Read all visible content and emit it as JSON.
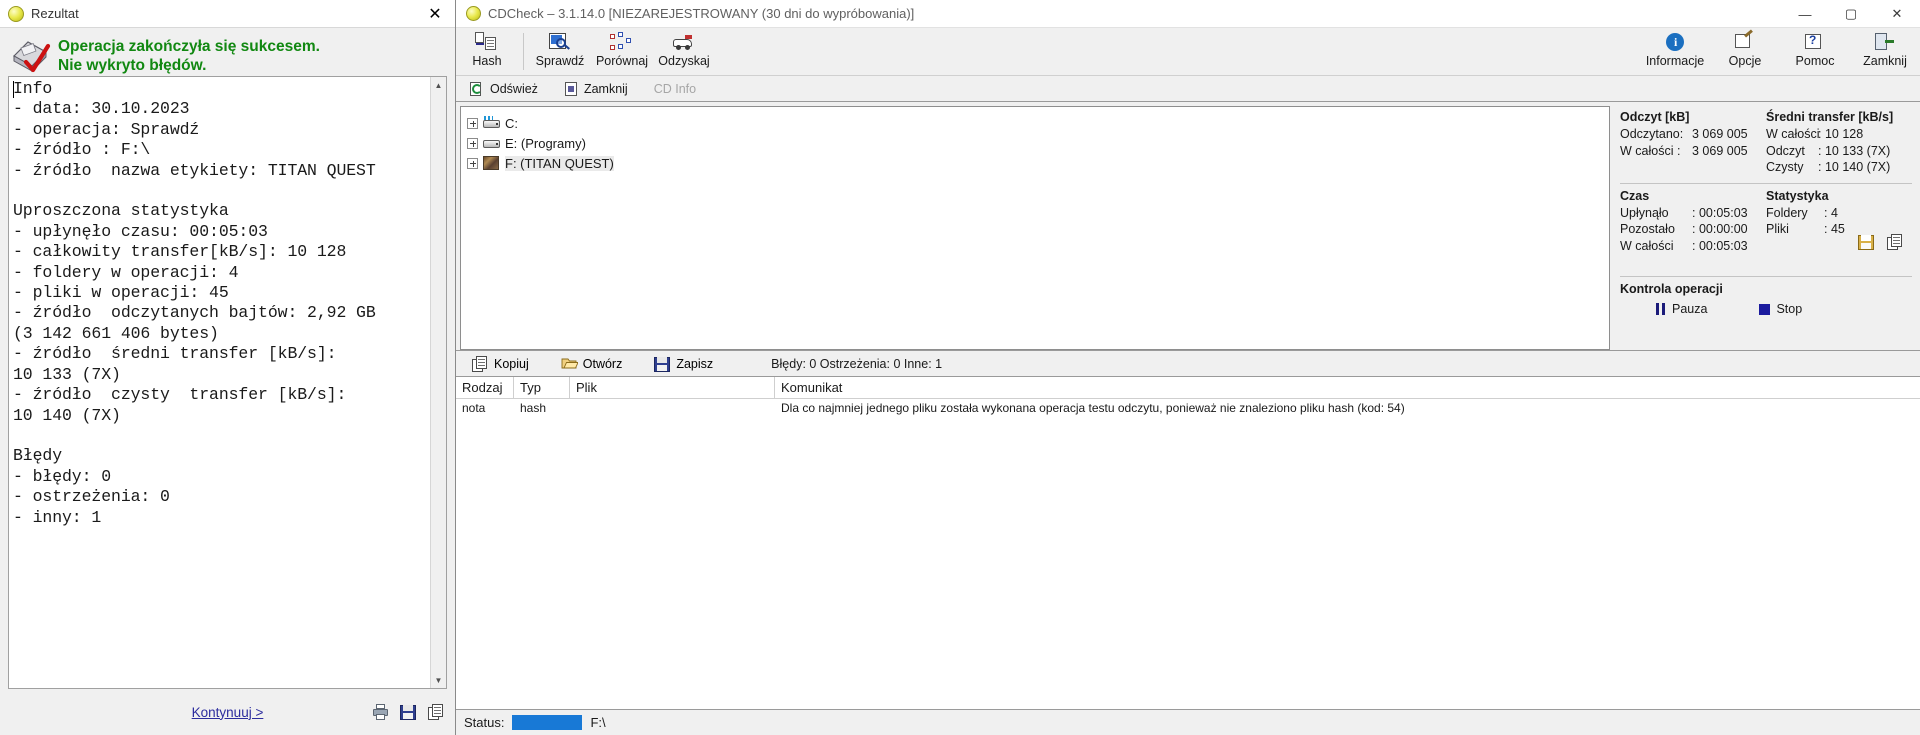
{
  "left_window": {
    "title": "Rezultat",
    "title_icon": "cdcheck-logo-icon",
    "close_label": "✕",
    "banner": {
      "line1": "Operacja zakończyła się sukcesem.",
      "line2": "Nie wykryto błędów.",
      "color": "#118811",
      "icon": "check-disc-icon"
    },
    "report_text": "Info\n- data: 30.10.2023\n- operacja: Sprawdź\n- źródło : F:\\\n- źródło  nazwa etykiety: TITAN QUEST\n\nUproszczona statystyka\n- upłynęło czasu: 00:05:03\n- całkowity transfer[kB/s]: 10 128\n- foldery w operacji: 4\n- pliki w operacji: 45\n- źródło  odczytanych bajtów: 2,92 GB\n(3 142 661 406 bytes)\n- źródło  średni transfer [kB/s]:\n10 133 (7X)\n- źródło  czysty  transfer [kB/s]:\n10 140 (7X)\n\nBłędy\n- błędy: 0\n- ostrzeżenia: 0\n- inny: 1\n",
    "continue_label": "Kontynuuj >",
    "footer_icons": [
      {
        "name": "print-icon",
        "label": "Drukuj"
      },
      {
        "name": "save-icon",
        "label": "Zapisz"
      },
      {
        "name": "copy-icon",
        "label": "Kopiuj"
      }
    ],
    "scroll_up": "▲",
    "scroll_down": "▼"
  },
  "right_window": {
    "title": "CDCheck – 3.1.14.0 [NIEZAREJESTROWANY (30 dni do wypróbowania)]",
    "window_buttons": {
      "minimize": "—",
      "maximize": "▢",
      "close": "✕"
    },
    "toolbar": {
      "left_items": [
        {
          "name": "hash-button",
          "label": "Hash",
          "accel": "H",
          "icon": "hash-document-icon"
        },
        {
          "name": "check-button",
          "label": "Sprawdź",
          "accel": "S",
          "icon": "magnifier-check-icon"
        },
        {
          "name": "compare-button",
          "label": "Porównaj",
          "accel": "o",
          "icon": "compare-nodes-icon"
        },
        {
          "name": "recover-button",
          "label": "Odzyskaj",
          "accel": "s",
          "icon": "ambulance-icon"
        }
      ],
      "right_items": [
        {
          "name": "info-button",
          "label": "Informacje",
          "icon": "info-circle-icon"
        },
        {
          "name": "options-button",
          "label": "Opcje",
          "icon": "options-pencil-icon"
        },
        {
          "name": "help-button",
          "label": "Pomoc",
          "icon": "help-question-icon"
        },
        {
          "name": "exit-button",
          "label": "Zamknij",
          "icon": "exit-door-icon"
        }
      ]
    },
    "toolbar2": [
      {
        "name": "refresh-button",
        "label": "Odśwież",
        "icon": "refresh-icon",
        "disabled": false
      },
      {
        "name": "close-tray-button",
        "label": "Zamknij",
        "icon": "eject-close-icon",
        "disabled": false
      },
      {
        "name": "cd-info-button",
        "label": "CD Info",
        "icon": "cd-info-icon",
        "disabled": true
      }
    ],
    "tree": [
      {
        "name": "tree-item-c",
        "label": "C:",
        "icon": "hdd-icon",
        "expandable": true,
        "selected": false
      },
      {
        "name": "tree-item-e",
        "label": "E: (Programy)",
        "icon": "hdd-icon",
        "expandable": true,
        "selected": false
      },
      {
        "name": "tree-item-f",
        "label": "F: (TITAN QUEST)",
        "icon": "cd-image-icon",
        "expandable": true,
        "selected": true
      }
    ],
    "stats": {
      "read": {
        "header": "Odczyt [kB]",
        "rows": [
          {
            "key": "Odczytano:",
            "value": "3 069 005"
          },
          {
            "key": "W całości  :",
            "value": "3 069 005"
          }
        ]
      },
      "transfer": {
        "header": "Średni transfer [kB/s]",
        "rows": [
          {
            "key": "W całości",
            "value": ": 10 128"
          },
          {
            "key": "Odczyt",
            "value": ": 10 133 (7X)"
          },
          {
            "key": "Czysty",
            "value": ": 10 140 (7X)"
          }
        ]
      },
      "time": {
        "header": "Czas",
        "rows": [
          {
            "key": "Upłynąło",
            "value": ": 00:05:03"
          },
          {
            "key": "Pozostało",
            "value": ": 00:00:00"
          },
          {
            "key": "W całości",
            "value": ": 00:05:03"
          }
        ]
      },
      "statistics": {
        "header": "Statystyka",
        "rows": [
          {
            "key": "Foldery",
            "value": ": 4"
          },
          {
            "key": "Pliki",
            "value": ": 45"
          }
        ]
      },
      "panel_icons": [
        {
          "name": "save-report-icon"
        },
        {
          "name": "copy-report-icon"
        }
      ],
      "control": {
        "header": "Kontrola operacji",
        "pause_label": "Pauza",
        "stop_label": "Stop",
        "pause_icon": "pause-icon",
        "stop_icon": "stop-icon"
      }
    },
    "log_toolbar": {
      "buttons": [
        {
          "name": "log-copy-button",
          "label": "Kopiuj",
          "icon": "copy-icon"
        },
        {
          "name": "log-open-button",
          "label": "Otwórz",
          "icon": "folder-open-icon"
        },
        {
          "name": "log-save-button",
          "label": "Zapisz",
          "icon": "floppy-save-icon"
        }
      ],
      "counts": "Błędy: 0 Ostrzeżenia: 0 Inne: 1"
    },
    "log_table": {
      "columns": [
        "Rodzaj",
        "Typ",
        "Plik",
        "Komunikat"
      ],
      "rows": [
        {
          "rodzaj": "nota",
          "typ": "hash",
          "plik": "",
          "komunikat": "Dla co najmniej jednego pliku została wykonana operacja testu odczytu, ponieważ nie znaleziono pliku hash (kod: 54)"
        }
      ]
    },
    "status_bar": {
      "label": "Status:",
      "progress_color": "#1879d6",
      "path": "F:\\"
    }
  }
}
